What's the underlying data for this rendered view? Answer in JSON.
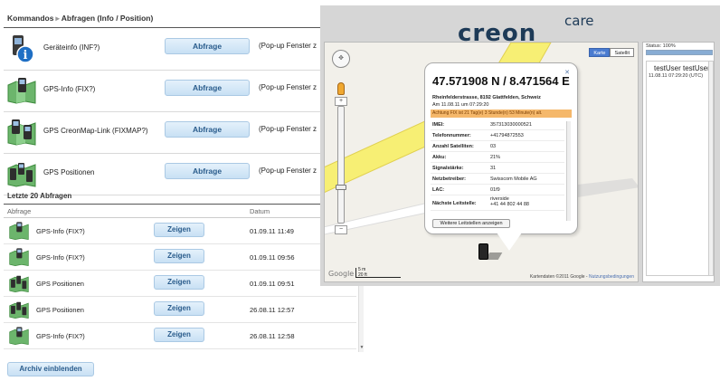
{
  "breadcrumb": {
    "root": "Kommandos",
    "current": "Abfragen (Info / Position)"
  },
  "commands": [
    {
      "icon": "info-device-icon",
      "label": "Geräteinfo (INF?)",
      "button": "Abfrage",
      "note": "(Pop-up Fenster z"
    },
    {
      "icon": "gps-map-icon",
      "label": "GPS-Info (FIX?)",
      "button": "Abfrage",
      "note": "(Pop-up Fenster z"
    },
    {
      "icon": "creonmap-link-icon",
      "label": "GPS CreonMap-Link (FIXMAP?)",
      "button": "Abfrage",
      "note": "(Pop-up Fenster z"
    },
    {
      "icon": "gps-positions-icon",
      "label": "GPS Positionen",
      "button": "Abfrage",
      "note": "(Pop-up Fenster z"
    }
  ],
  "history": {
    "title": "Letzte 20 Abfragen",
    "columns": [
      "Abfrage",
      "Datum"
    ],
    "rows": [
      {
        "icon": "gps-map-icon",
        "label": "GPS-Info (FIX?)",
        "button": "Zeigen",
        "date": "01.09.11 11:49"
      },
      {
        "icon": "gps-map-icon",
        "label": "GPS-Info (FIX?)",
        "button": "Zeigen",
        "date": "01.09.11 09:56"
      },
      {
        "icon": "gps-positions-icon",
        "label": "GPS Positionen",
        "button": "Zeigen",
        "date": "01.09.11 09:51"
      },
      {
        "icon": "gps-positions-icon",
        "label": "GPS Positionen",
        "button": "Zeigen",
        "date": "26.08.11 12:57"
      },
      {
        "icon": "gps-map-icon",
        "label": "GPS-Info (FIX?)",
        "button": "Zeigen",
        "date": "26.08.11 12:58"
      }
    ],
    "archive_button": "Archiv einblenden"
  },
  "brand": {
    "prefix": "creon",
    "suffix": "care"
  },
  "map": {
    "tabs": [
      "Karte",
      "Satellit"
    ],
    "active_tab": "Karte",
    "google": "Google",
    "scale": [
      "5 m",
      "20 ft"
    ],
    "attribution": "Kartendaten ©2011 Google -",
    "terms_link": "Nutzungsbedingungen",
    "colors": {
      "road_yellow": "#f7ef74",
      "road_light": "#ffffff",
      "land": "#f2f0ea",
      "map_tab_active": "#4a7bd0"
    }
  },
  "infowindow": {
    "title": "47.571908 N / 8.471564 E",
    "address": "Rheinfelderstrasse, 8192 Glattfelden, Schweiz",
    "time": "Am 11.08.11 um 07:29:20",
    "warning": "Achtung FIX ist 21 Tag(e) 3 Stunde(n) 53 Minute(n) alt.",
    "rows": [
      {
        "key": "IMEI:",
        "value": "357313030000521"
      },
      {
        "key": "Telefonnummer:",
        "value": "+41794872553"
      },
      {
        "key": "Anzahl Satelliten:",
        "value": "03"
      },
      {
        "key": "Akku:",
        "value": "21%"
      },
      {
        "key": "Signalstärke:",
        "value": "31"
      },
      {
        "key": "Netzbetreiber:",
        "value": "Swisscom Mobile AG"
      },
      {
        "key": "LAC:",
        "value": "01f9"
      },
      {
        "key": "Nächste Leitstelle:",
        "value": "riverside\n+41 44 802 44 88"
      }
    ],
    "more_button": "Weitere Leitstellen anzeigen"
  },
  "status_panel": {
    "status_label": "Status: 100%",
    "progress_percent": 100,
    "user": "testUser testUser",
    "timestamp": "11.08.11 07:29:20 (UTC)"
  }
}
